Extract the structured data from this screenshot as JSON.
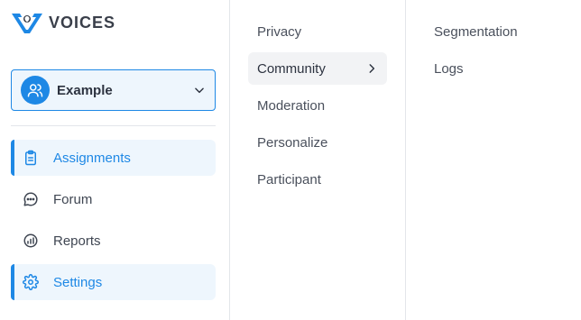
{
  "brand": {
    "name": "VOICES",
    "accent": "#1e88e5",
    "icon": "voices-logo-icon"
  },
  "workspace": {
    "label": "Example",
    "icon": "users-icon"
  },
  "nav": [
    {
      "label": "Assignments",
      "icon": "clipboard-icon",
      "active": true
    },
    {
      "label": "Forum",
      "icon": "chat-bubble-icon",
      "active": false
    },
    {
      "label": "Reports",
      "icon": "chart-icon",
      "active": false
    },
    {
      "label": "Settings",
      "icon": "gear-icon",
      "active": true
    }
  ],
  "settings_menu": [
    {
      "label": "Privacy"
    },
    {
      "label": "Community",
      "selected": true
    },
    {
      "label": "Moderation"
    },
    {
      "label": "Personalize"
    },
    {
      "label": "Participant"
    }
  ],
  "community_menu": [
    {
      "label": "Segmentation"
    },
    {
      "label": "Logs"
    }
  ]
}
